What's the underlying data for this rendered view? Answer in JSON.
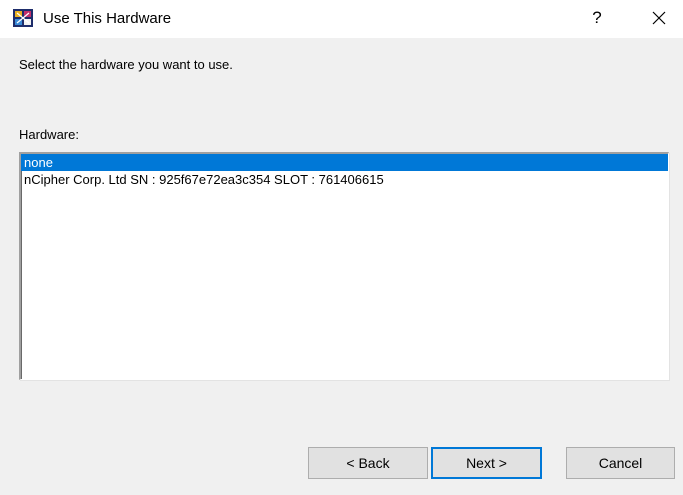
{
  "window": {
    "title": "Use This Hardware",
    "help_label": "?",
    "app_icon": "hardware-app-icon",
    "close_icon": "close-icon"
  },
  "content": {
    "instruction": "Select the hardware you want to use.",
    "hardware_label": "Hardware:",
    "items": [
      {
        "label": "none",
        "selected": true
      },
      {
        "label": "nCipher Corp. Ltd  SN : 925f67e72ea3c354 SLOT : 761406615",
        "selected": false
      }
    ]
  },
  "buttons": {
    "back": "< Back",
    "next": "Next >",
    "cancel": "Cancel"
  },
  "colors": {
    "selection": "#0078d7",
    "dialog_bg": "#f0f0f0"
  }
}
